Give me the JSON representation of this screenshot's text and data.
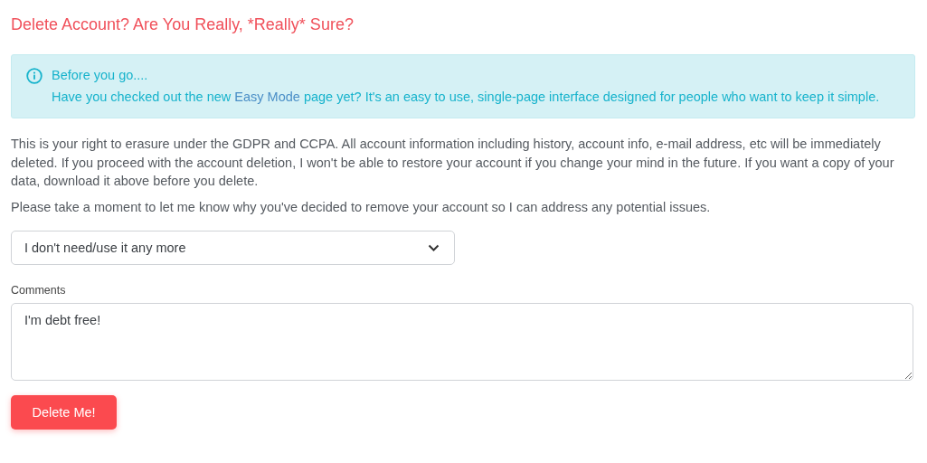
{
  "title": "Delete Account? Are You Really, *Really* Sure?",
  "notice": {
    "heading": "Before you go....",
    "text_before": "Have you checked out the new",
    "link": "Easy Mode",
    "text_after": "page yet? It's an easy to use, single-page interface designed for people who want to keep it simple."
  },
  "paragraphs": [
    "This is your right to erasure under the GDPR and CCPA. All account information including history, account info, e-mail address, etc will be immediately deleted. If you proceed with the account deletion, I won't be able to restore your account if you change your mind in the future. If you want a copy of your data, download it above before you delete.",
    "Please take a moment to let me know why you've decided to remove your account so I can address any potential issues."
  ],
  "reason_select": {
    "value": "I don't need/use it any more"
  },
  "comments": {
    "label": "Comments",
    "value": "I'm debt free!"
  },
  "submit_button": "Delete Me!"
}
